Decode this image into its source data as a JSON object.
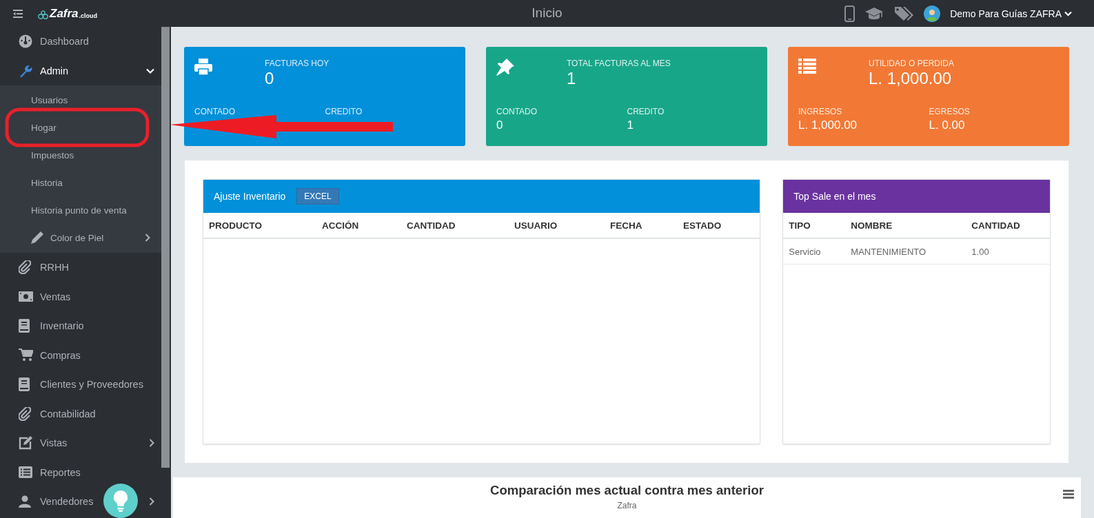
{
  "header": {
    "logo": "Zafra",
    "logo_suffix": ".cloud",
    "title": "Inicio",
    "user": "Demo Para Guías ZAFRA"
  },
  "sidebar": {
    "items": [
      {
        "label": "Dashboard"
      },
      {
        "label": "Admin",
        "expanded": true,
        "children": [
          {
            "label": "Usuarios"
          },
          {
            "label": "Hogar"
          },
          {
            "label": "Impuestos"
          },
          {
            "label": "Historia"
          },
          {
            "label": "Historia punto de venta"
          },
          {
            "label": "Color de Piel",
            "expanded": false
          }
        ]
      },
      {
        "label": "RRHH"
      },
      {
        "label": "Ventas"
      },
      {
        "label": "Inventario"
      },
      {
        "label": "Compras"
      },
      {
        "label": "Clientes y Proveedores"
      },
      {
        "label": "Contabilidad"
      },
      {
        "label": "Vistas",
        "expanded": false
      },
      {
        "label": "Reportes"
      },
      {
        "label": "Vendedores",
        "expanded": false
      }
    ]
  },
  "cards": [
    {
      "color": "#0190d9",
      "title": "FACTURAS HOY",
      "value": "0",
      "left_label": "CONTADO",
      "right_label": "CREDITO"
    },
    {
      "color": "#18a689",
      "title": "TOTAL FACTURAS AL MES",
      "value": "1",
      "left_label": "CONTADO",
      "left_value": "0",
      "right_label": "CREDITO",
      "right_value": "1"
    },
    {
      "color": "#f27935",
      "title": "UTILIDAD O PERDIDA",
      "value": "L. 1,000.00",
      "left_label": "INGRESOS",
      "left_value": "L. 1,000.00",
      "right_label": "EGRESOS",
      "right_value": "L. 0.00"
    }
  ],
  "inventory_panel": {
    "title": "Ajuste Inventario",
    "button": "EXCEL",
    "columns": [
      "PRODUCTO",
      "ACCIÓN",
      "CANTIDAD",
      "USUARIO",
      "FECHA",
      "ESTADO"
    ]
  },
  "top_sale_panel": {
    "title": "Top Sale en el mes",
    "columns": [
      "TIPO",
      "NOMBRE",
      "CANTIDAD"
    ],
    "rows": [
      [
        "Servicio",
        "MANTENIMIENTO",
        "1.00"
      ]
    ]
  },
  "chart_panel": {
    "title": "Comparación mes actual contra mes anterior",
    "subtitle": "Zafra"
  }
}
